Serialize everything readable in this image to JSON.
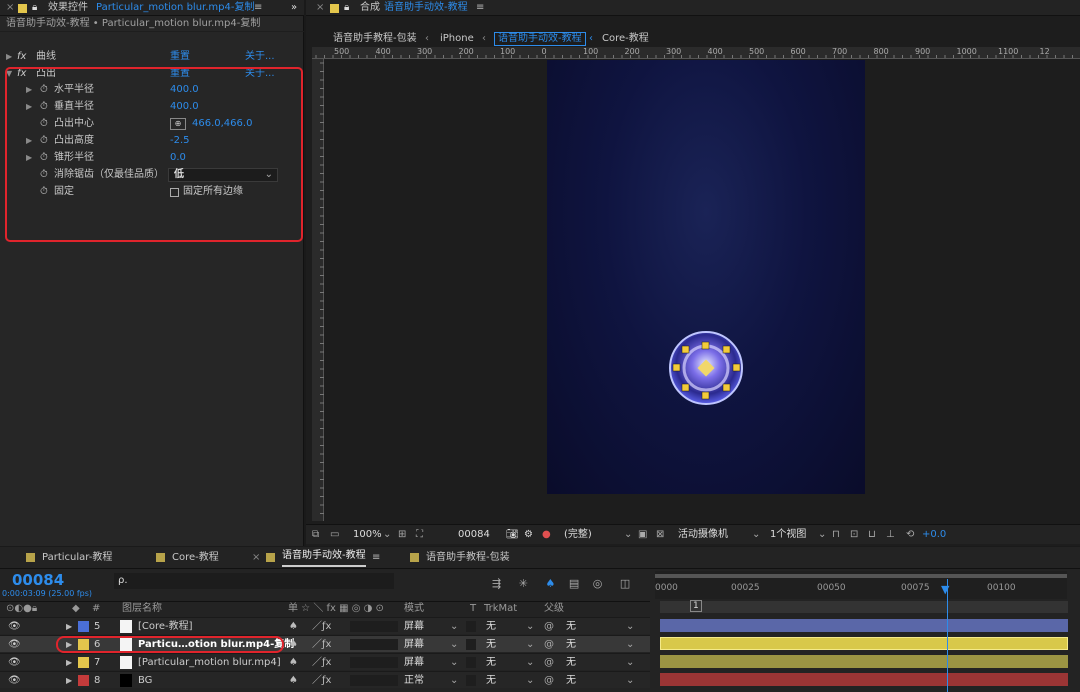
{
  "effects_panel": {
    "tab_close": "×",
    "tab_title_prefix": "效果控件",
    "tab_title_file": "Particular_motion blur.mp4-复制",
    "tab_menu": "≡",
    "collapse": "»",
    "breadcrumb": "语音助手动效-教程 • Particular_motion blur.mp4-复制",
    "effects": [
      {
        "name": "曲线",
        "reset": "重置",
        "about": "关于..."
      },
      {
        "name": "凸出",
        "reset": "重置",
        "about": "关于..."
      }
    ],
    "properties": [
      {
        "label": "水平半径",
        "value": "400.0"
      },
      {
        "label": "垂直半径",
        "value": "400.0"
      },
      {
        "label": "凸出中心",
        "value": "466.0,466.0"
      },
      {
        "label": "凸出高度",
        "value": "-2.5"
      },
      {
        "label": "锥形半径",
        "value": "0.0"
      },
      {
        "label": "消除锯齿（仅最佳品质）",
        "value": "低"
      },
      {
        "label": "固定",
        "value": "固定所有边缘"
      }
    ],
    "fx_glyph": "fx",
    "highlight_color": "#e0242c"
  },
  "comp_panel": {
    "tab_close": "×",
    "tab_prefix": "合成",
    "tab_title": "语音助手动效-教程",
    "tab_menu": "≡",
    "crumbs": [
      "语音助手教程-包装",
      "iPhone",
      "语音助手动效-教程",
      "Core-教程"
    ],
    "ruler_labels": [
      "500",
      "400",
      "300",
      "200",
      "100",
      "0",
      "100",
      "200",
      "300",
      "400",
      "500",
      "600",
      "700",
      "800",
      "900",
      "1000",
      "1100",
      "12"
    ],
    "zoom": "100%",
    "timecode": "00084",
    "resolution": "(完整)",
    "camera": "活动摄像机",
    "views": "1个视图",
    "exposure": "+0.0",
    "chevron": "⌄"
  },
  "timeline_panel": {
    "tabs": [
      {
        "label": "Particular-教程",
        "color": "#b7a34a"
      },
      {
        "label": "Core-教程",
        "color": "#b7a34a"
      },
      {
        "label": "语音助手动效-教程",
        "color": "#b7a34a",
        "menu": "≡",
        "close": "×"
      },
      {
        "label": "语音助手教程-包装",
        "color": "#b7a34a"
      }
    ],
    "timecode": "00084",
    "timecode_sub": "0:00:03:09 (25.00 fps)",
    "search_icon_text": "ρ.",
    "columns": {
      "hash": "#",
      "name": "图层名称",
      "switches": "单 ☆ ＼ fx ▦ ◎ ◑ ⊙",
      "mode": "模式",
      "t": "T",
      "trkmat": "TrkMat",
      "parent": "父级"
    },
    "ruler": [
      "0000",
      "00025",
      "00050",
      "00075",
      "00100"
    ],
    "marker": "1",
    "layers": [
      {
        "num": "5",
        "name": "[Core-教程]",
        "label_color": "#4a6fd8",
        "mode": "屏幕",
        "trkmat": "无",
        "parent": "无",
        "bar_color": "#5a67a8"
      },
      {
        "num": "6",
        "name": "Particu…otion blur.mp4-复制",
        "label_color": "#e3c64c",
        "mode": "屏幕",
        "trkmat": "无",
        "parent": "无",
        "bar_color": "#d8c84a"
      },
      {
        "num": "7",
        "name": "[Particular_motion blur.mp4]",
        "label_color": "#e3c64c",
        "mode": "屏幕",
        "trkmat": "无",
        "parent": "无",
        "bar_color": "#9b9443"
      },
      {
        "num": "8",
        "name": "BG",
        "label_color": "#c43b3b",
        "mode": "正常",
        "trkmat": "无",
        "parent": "无",
        "bar_color": "#9b3535"
      }
    ]
  }
}
